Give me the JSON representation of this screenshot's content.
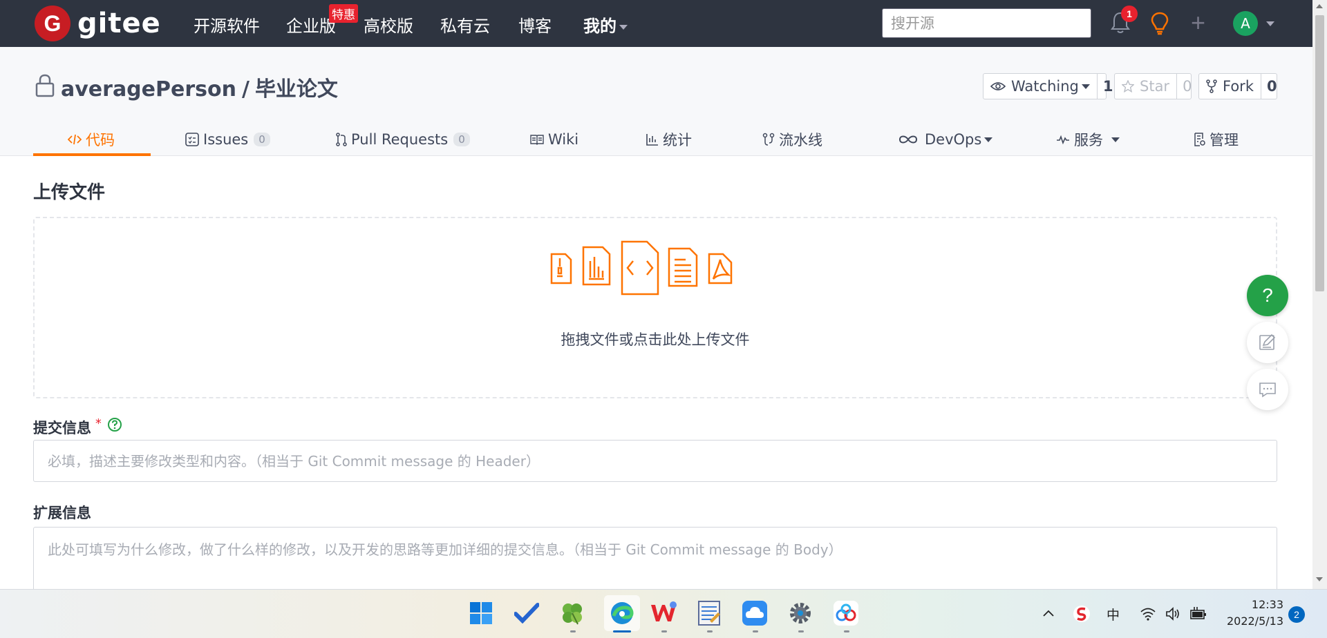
{
  "topnav": {
    "logo_letter": "G",
    "logo_text": "gitee",
    "items": [
      "开源软件",
      "企业版",
      "高校版",
      "私有云",
      "博客",
      "我的"
    ],
    "badge": "特惠",
    "search_placeholder": "搜开源",
    "notification_count": "1",
    "avatar_letter": "A"
  },
  "repo": {
    "owner": "averagePerson",
    "separator": "/",
    "name": "毕业论文",
    "watch": {
      "label": "Watching",
      "count": "1"
    },
    "star": {
      "label": "Star",
      "count": "0"
    },
    "fork": {
      "label": "Fork",
      "count": "0"
    }
  },
  "tabs": [
    {
      "label": "代码",
      "icon": "code-icon",
      "active": true
    },
    {
      "label": "Issues",
      "count": "0",
      "icon": "issues-icon"
    },
    {
      "label": "Pull Requests",
      "count": "0",
      "icon": "pull-request-icon"
    },
    {
      "label": "Wiki",
      "icon": "book-icon"
    },
    {
      "label": "统计",
      "icon": "bar-chart-icon"
    },
    {
      "label": "流水线",
      "icon": "pipeline-icon"
    },
    {
      "label": "DevOps",
      "icon": "infinity-icon"
    },
    {
      "label": "服务",
      "icon": "pulse-icon"
    },
    {
      "label": "管理",
      "icon": "settings-doc-icon"
    }
  ],
  "upload": {
    "title": "上传文件",
    "dropzone_text": "拖拽文件或点击此处上传文件"
  },
  "commit": {
    "label": "提交信息",
    "required_mark": "*",
    "placeholder": "必填，描述主要修改类型和内容。（相当于 Git Commit message 的 Header）"
  },
  "extended": {
    "label": "扩展信息",
    "placeholder": "此处可填写为什么修改，做了什么样的修改，以及开发的思路等更加详细的提交信息。（相当于 Git Commit message 的 Body）"
  },
  "floating": {
    "help_label": "?"
  },
  "taskbar": {
    "ime": "中",
    "time": "12:33",
    "date": "2022/5/13",
    "notifications": "2"
  },
  "colors": {
    "accent": "#fe7300",
    "nav_bg": "#2e3440",
    "brand_red": "#c71d23",
    "help_green": "#24a148"
  }
}
